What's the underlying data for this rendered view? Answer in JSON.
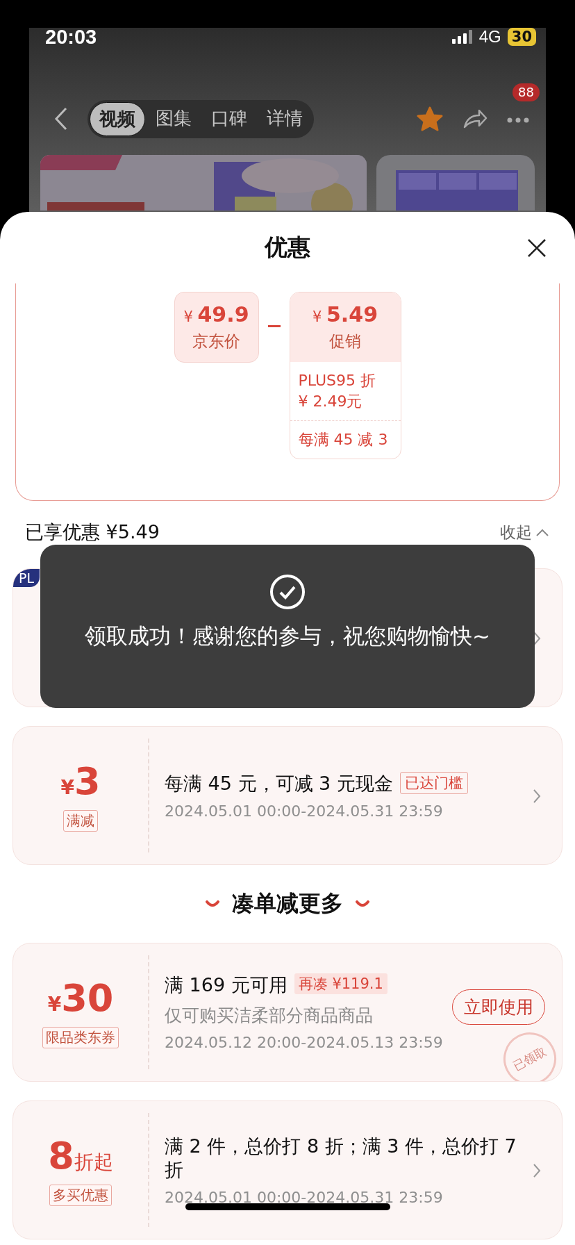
{
  "status_bar": {
    "time": "20:03",
    "network": "4G",
    "battery": "30"
  },
  "nav": {
    "tabs": [
      {
        "label": "视频",
        "selected": true
      },
      {
        "label": "图集",
        "selected": false
      },
      {
        "label": "口碑",
        "selected": false
      },
      {
        "label": "详情",
        "selected": false
      }
    ],
    "more_badge": "88"
  },
  "sheet": {
    "title": "优惠"
  },
  "price_breakdown": {
    "base": {
      "currency": "¥",
      "amount": "49.9",
      "label": "京东价"
    },
    "promo": {
      "currency": "¥",
      "amount": "5.49",
      "label": "促销",
      "details": [
        {
          "lines": [
            "PLUS95 折",
            "¥ 2.49元"
          ]
        },
        {
          "lines": [
            "每满 45 减 3"
          ]
        }
      ]
    }
  },
  "summary": {
    "label": "已享优惠 ¥5.49",
    "collapse": "收起"
  },
  "coupons": [
    {
      "corner_badge": "PL",
      "action": {
        "kind": "chevron"
      }
    },
    {
      "value_prefix": "¥",
      "value": "3",
      "tag": "满减",
      "title": "每满 45 元，可减 3 元现金",
      "status_tag": {
        "kind": "outline",
        "label": "已达门槛"
      },
      "date": "2024.05.01 00:00-2024.05.31 23:59",
      "action": {
        "kind": "chevron"
      }
    }
  ],
  "more": {
    "title": "凑单减更多",
    "coupons": [
      {
        "value_prefix": "¥",
        "value": "30",
        "tag": "限品类东券",
        "title": "满 169 元可用",
        "status_tag": {
          "kind": "filled",
          "label": "再凑 ¥119.1"
        },
        "subtitle": "仅可购买洁柔部分商品商品",
        "date": "2024.05.12 20:00-2024.05.13 23:59",
        "action": {
          "kind": "button",
          "label": "立即使用"
        },
        "stamp": "已领取"
      },
      {
        "value": "8",
        "value_suffix": "折起",
        "tag": "多买优惠",
        "title": "满 2 件，总价打 8 折；满 3 件，总价打 7 折",
        "date": "2024.05.01 00:00-2024.05.31 23:59",
        "action": {
          "kind": "chevron"
        }
      }
    ]
  },
  "toast": {
    "message": "领取成功！感谢您的参与，祝您购物愉快~"
  }
}
